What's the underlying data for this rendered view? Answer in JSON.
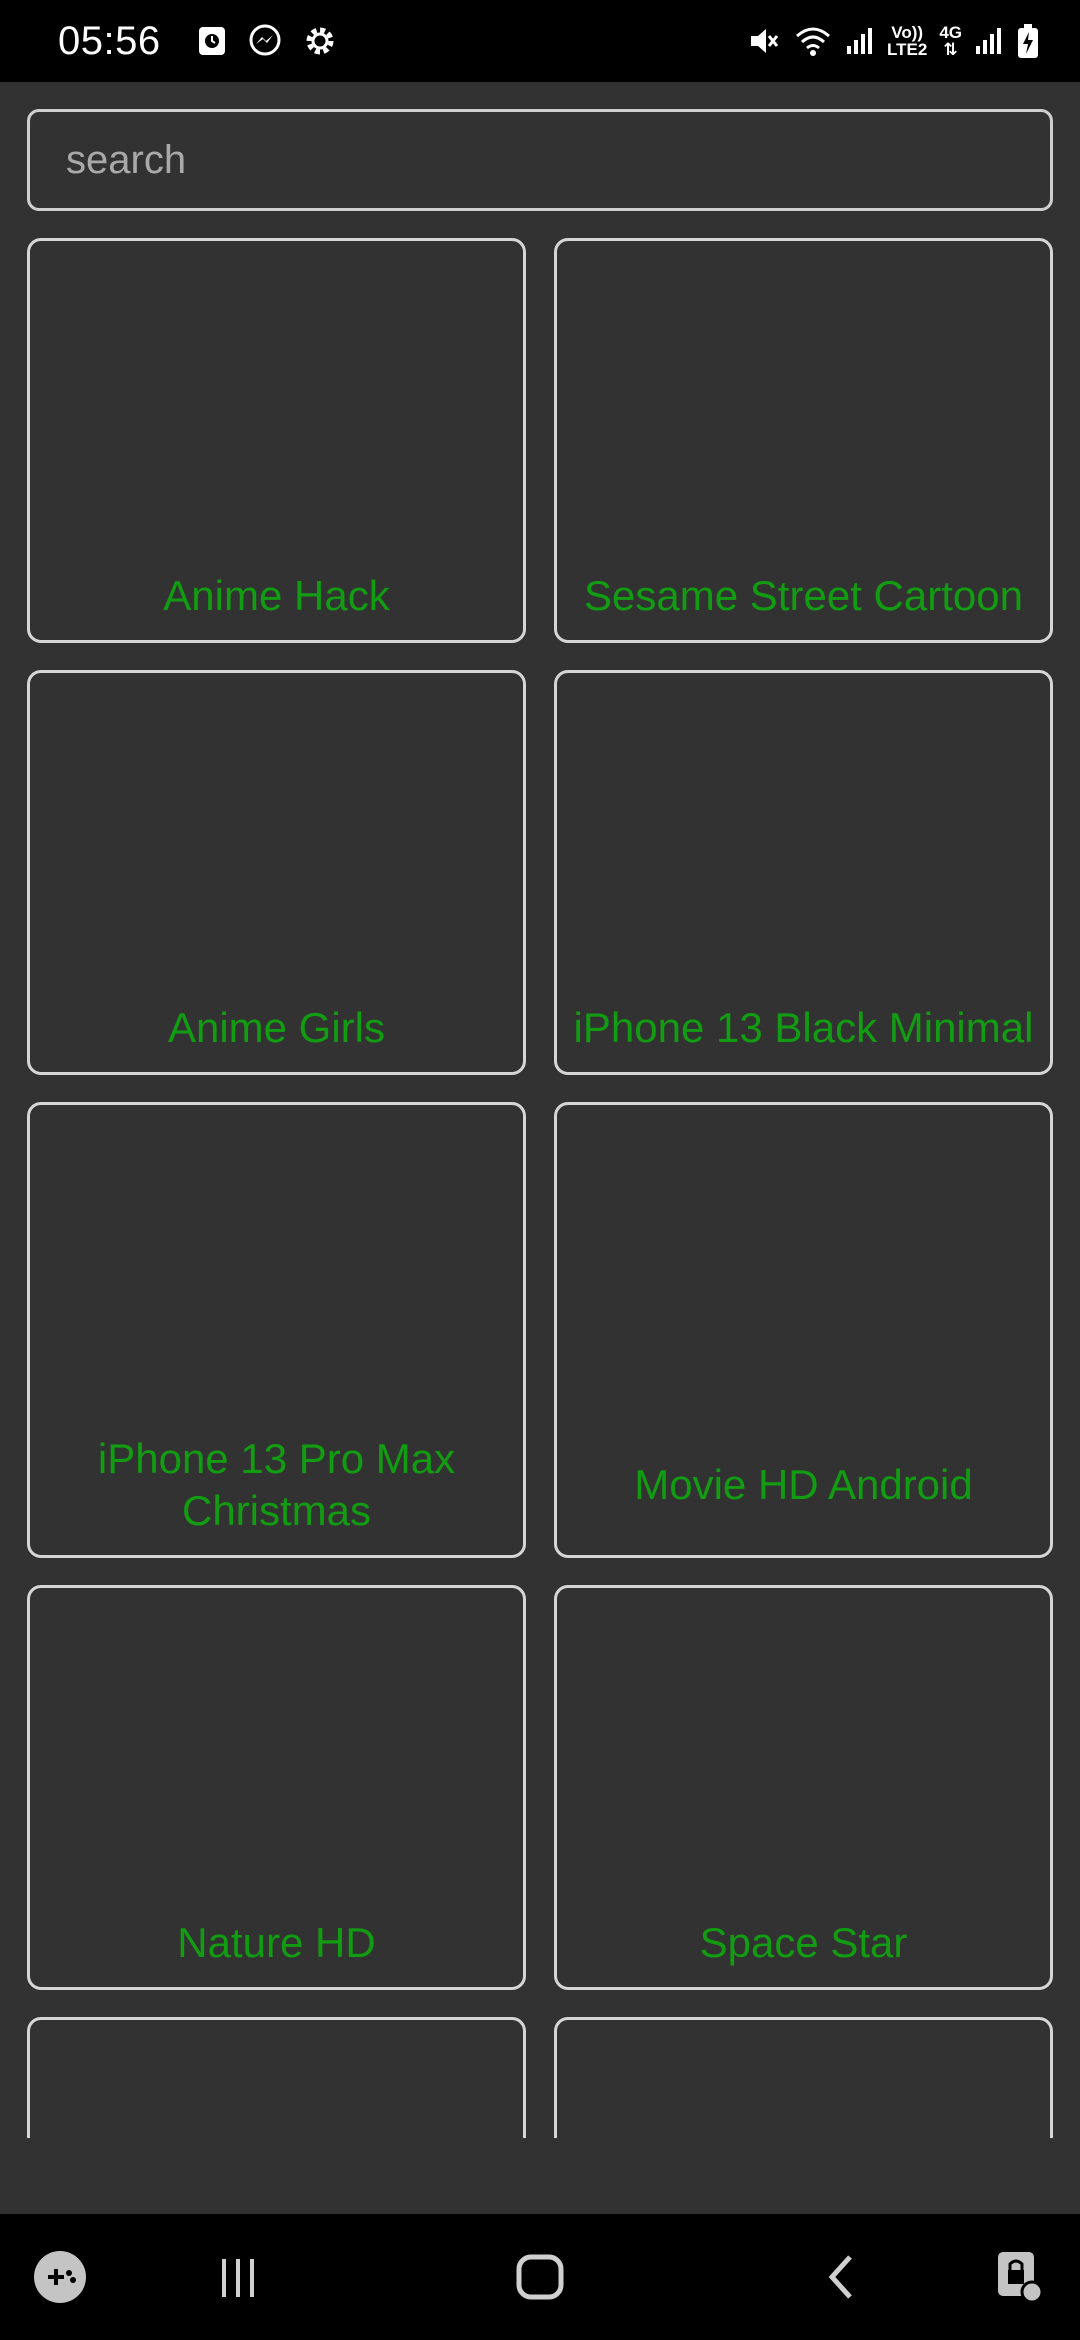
{
  "status_bar": {
    "time": "05:56",
    "volte_line1": "Vo))",
    "volte_line2": "LTE2",
    "network": "4G"
  },
  "search": {
    "placeholder": "search",
    "value": ""
  },
  "cards": [
    {
      "title": "Anime Hack"
    },
    {
      "title": "Sesame Street Cartoon"
    },
    {
      "title": "Anime Girls"
    },
    {
      "title": "iPhone 13 Black Minimal"
    },
    {
      "title": "iPhone 13 Pro Max Christmas"
    },
    {
      "title": "Movie HD Android"
    },
    {
      "title": "Nature HD"
    },
    {
      "title": "Space Star"
    }
  ],
  "colors": {
    "background": "#323232",
    "card_border": "#d6d6d6",
    "title_green": "#129c12",
    "bars": "#000000"
  },
  "nav_bar": {
    "icons": [
      "game-launcher-icon",
      "recent-apps-icon",
      "home-icon",
      "back-icon",
      "screen-lock-icon"
    ]
  }
}
